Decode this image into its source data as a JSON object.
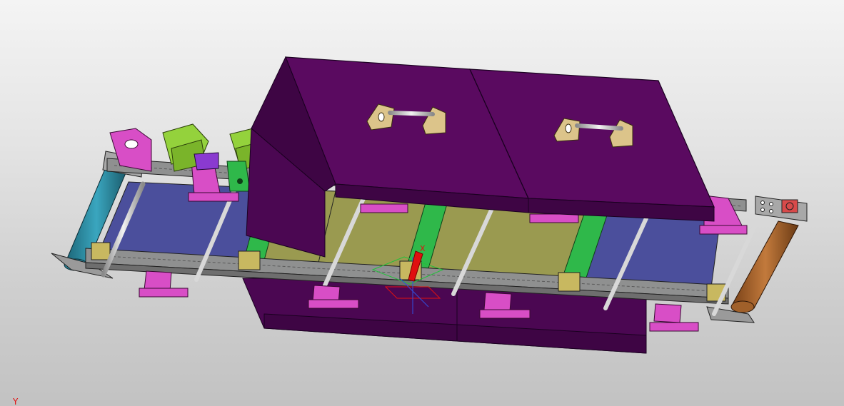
{
  "viewport": {
    "triad_axis_label": "X",
    "corner_axis_label": "Y"
  },
  "colors": {
    "background_top": "#f4f4f4",
    "background_bottom": "#c2c2c2",
    "oven_housing": "#5a0a60",
    "oven_housing_dark": "#3e0544",
    "oven_housing_side": "#4b0752",
    "belt_blue": "#4b4f9c",
    "belt_olive": "#9a9a50",
    "green_cleat": "#2fb84a",
    "magenta_bracket": "#d84ec6",
    "lime_bracket": "#94d23c",
    "rail_gray": "#8f9090",
    "roller_teal": "#2a8aa0",
    "roller_bronze": "#a0602a",
    "handle_tan": "#dcc48a",
    "triad_red": "#e01010"
  },
  "icons": [
    "coordinate-triad-icon",
    "handle-icon"
  ]
}
